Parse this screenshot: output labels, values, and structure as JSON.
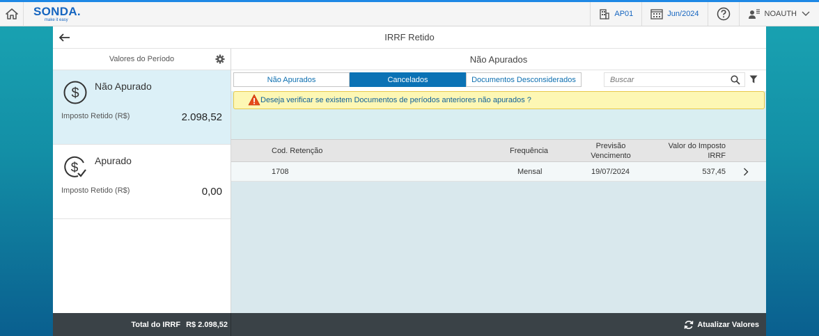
{
  "app": {
    "logo": "SONDA.",
    "tagline": "make it easy"
  },
  "topbar": {
    "company": "AP01",
    "period": "Jun/2024",
    "user": "NOAUTH"
  },
  "page": {
    "title": "IRRF Retido"
  },
  "left_panel": {
    "header": "Valores do Período",
    "cards": [
      {
        "title": "Não Apurado",
        "label": "Imposto Retido (R$)",
        "value": "2.098,52"
      },
      {
        "title": "Apurado",
        "label": "Imposto Retido (R$)",
        "value": "0,00"
      }
    ]
  },
  "right_panel": {
    "header": "Não Apurados",
    "tabs": [
      {
        "label": "Não Apurados",
        "selected": false
      },
      {
        "label": "Cancelados",
        "selected": true
      },
      {
        "label": "Documentos Desconsiderados",
        "selected": false
      }
    ],
    "search_placeholder": "Buscar",
    "warning": "Deseja verificar se existem Documentos de períodos anteriores não apurados ?",
    "table": {
      "columns": [
        "Cod. Retenção",
        "Frequência",
        "Previsão Vencimento",
        "Valor do Imposto IRRF"
      ],
      "rows": [
        {
          "cod": "1708",
          "frequencia": "Mensal",
          "vencimento": "19/07/2024",
          "valor": "537,45"
        }
      ]
    }
  },
  "footer": {
    "total_label": "Total do IRRF",
    "total_value": "R$ 2.098,52",
    "refresh_label": "Atualizar Valores"
  },
  "colors": {
    "accent": "#0b72b5",
    "selected_card": "#dcf0f7",
    "warning_bg": "#fdf7b4",
    "footer_bg": "#3a4247"
  }
}
